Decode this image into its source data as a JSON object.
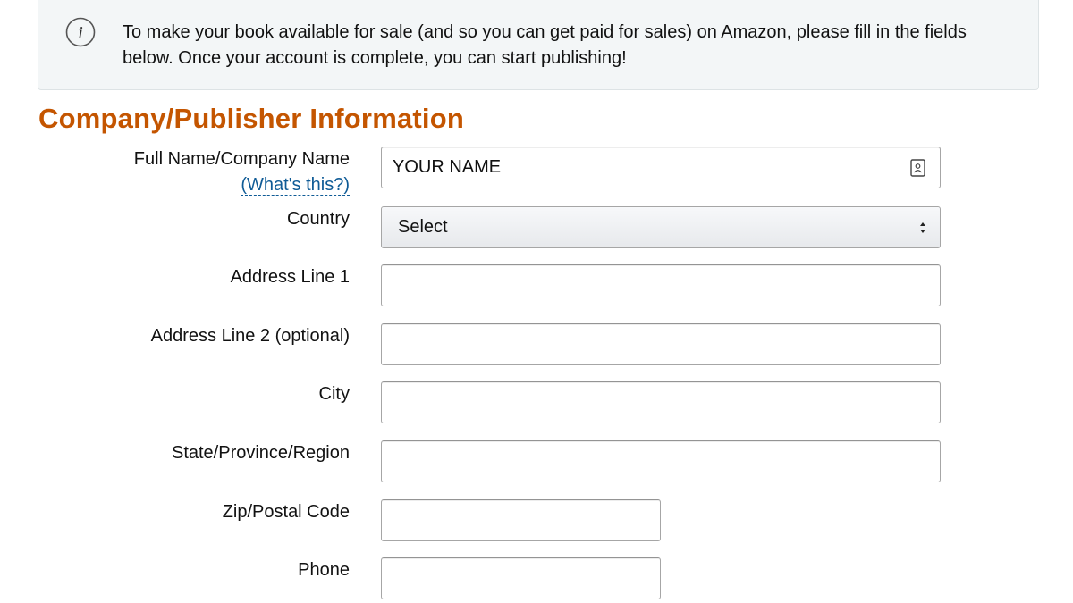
{
  "notice": {
    "icon": "info-icon",
    "text": "To make your book available for sale (and so you can get paid for sales) on Amazon, please fill in the fields below. Once your account is complete, you can start publishing!"
  },
  "section": {
    "title": "Company/Publisher Information"
  },
  "colors": {
    "heading": "#c45500",
    "link": "#0f5b96",
    "notice_bg": "#f3f6f7"
  },
  "form": {
    "full_name": {
      "label": "Full Name/Company Name",
      "help_link": "(What's this?)",
      "value": "YOUR NAME",
      "icon": "contact-card-icon"
    },
    "country": {
      "label": "Country",
      "selected": "Select",
      "icon": "select-caret-icon"
    },
    "address1": {
      "label": "Address Line 1",
      "value": ""
    },
    "address2": {
      "label": "Address Line 2 (optional)",
      "value": ""
    },
    "city": {
      "label": "City",
      "value": ""
    },
    "state": {
      "label": "State/Province/Region",
      "value": ""
    },
    "zip": {
      "label": "Zip/Postal Code",
      "value": ""
    },
    "phone": {
      "label": "Phone",
      "value": ""
    }
  }
}
